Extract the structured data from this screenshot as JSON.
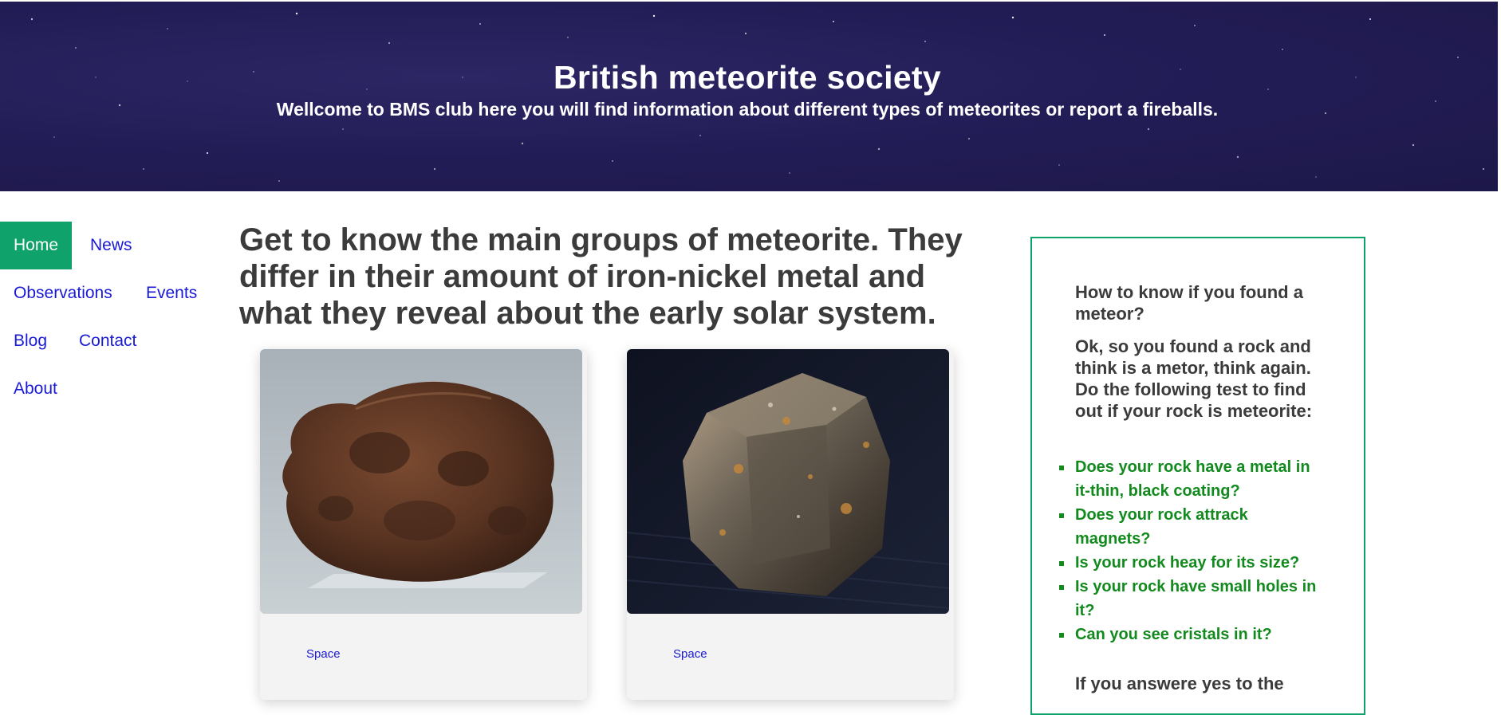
{
  "header": {
    "title": "British meteorite society",
    "subtitle": "Wellcome to BMS club here you will find information about different types of meteorites or report a fireballs."
  },
  "nav": {
    "items": [
      {
        "label": "Home",
        "active": true
      },
      {
        "label": "News"
      },
      {
        "label": "Observations"
      },
      {
        "label": "Events"
      },
      {
        "label": "Blog"
      },
      {
        "label": "Contact"
      },
      {
        "label": "About"
      }
    ]
  },
  "main": {
    "title": "Get to know the main groups of meteorite. They differ in their amount of iron-nickel metal and what they reveal about the early solar system.",
    "cards": [
      {
        "tag": "Space"
      },
      {
        "tag": "Space"
      }
    ]
  },
  "aside": {
    "title": "How to know if you found a meteor?",
    "intro": "Ok, so you found a rock and think is a metor, think again. Do the following test to find out if your rock is meteorite:",
    "checklist": [
      "Does your rock have a metal in it-thin, black coating?",
      "Does your rock attrack magnets?",
      "Is your rock heay for its size?",
      "Is your rock have small holes in it?",
      "Can you see cristals in it?"
    ],
    "outro": "If you answere yes to the"
  },
  "colors": {
    "header_bg": "#231d57",
    "accent_green": "#0fa36b",
    "link_blue": "#1a1ad6",
    "checklist_green": "#128a1e",
    "heading_gray": "#3b3b3b"
  }
}
